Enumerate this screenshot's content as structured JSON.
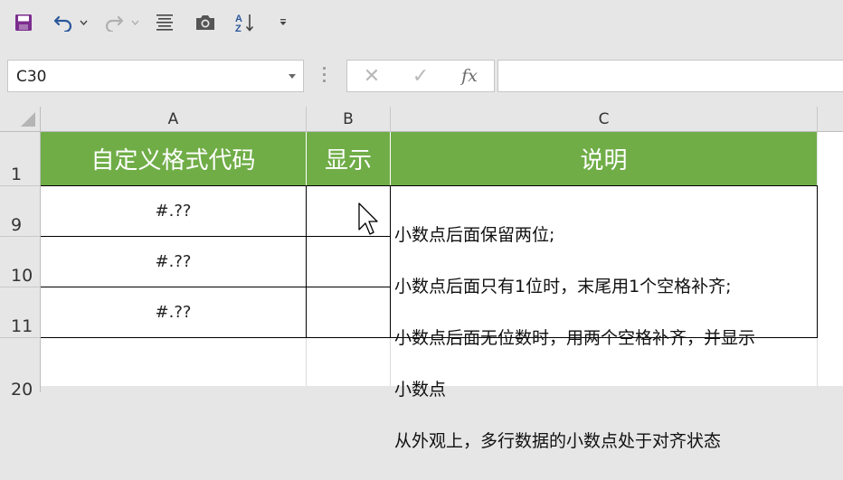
{
  "toolbar": {
    "items": [
      "save-icon",
      "undo-icon",
      "undo-dropdown-icon",
      "redo-icon",
      "redo-dropdown-icon",
      "align-icon",
      "camera-icon",
      "sort-icon",
      "customize-icon"
    ]
  },
  "formula_bar": {
    "name_box": "C30",
    "cancel_glyph": "✕",
    "enter_glyph": "✓",
    "fx_label": "fx",
    "formula_value": ""
  },
  "columns": [
    "A",
    "B",
    "C"
  ],
  "rows": [
    "1",
    "9",
    "10",
    "11",
    "20"
  ],
  "header_row": {
    "a": "自定义格式代码",
    "b": "显示",
    "c": "说明"
  },
  "data_rows": [
    {
      "a": "#.??",
      "b": ""
    },
    {
      "a": "#.??",
      "b": ""
    },
    {
      "a": "#.??",
      "b": ""
    }
  ],
  "note": {
    "lines": [
      "小数点后面保留两位;",
      "小数点后面只有1位时，末尾用1个空格补齐;",
      "小数点后面无位数时，用两个空格补齐，并显示",
      "小数点",
      "从外观上，多行数据的小数点处于对齐状态"
    ]
  },
  "colors": {
    "header_fill": "#70ad47",
    "header_text": "#ffffff",
    "accent_purple": "#7b2d8e",
    "accent_blue": "#2b579a"
  }
}
